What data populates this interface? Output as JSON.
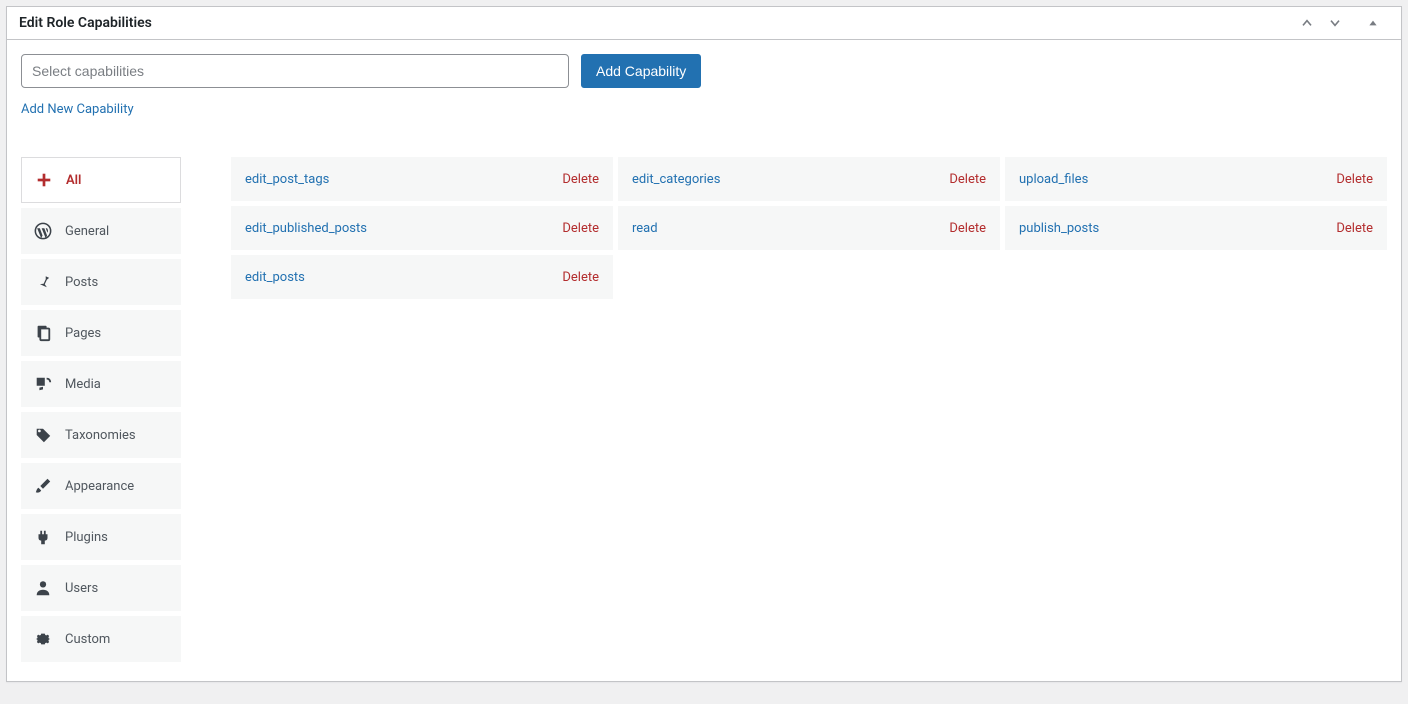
{
  "panel": {
    "title": "Edit Role Capabilities"
  },
  "search": {
    "placeholder": "Select capabilities"
  },
  "buttons": {
    "add_capability": "Add Capability",
    "add_new_capability": "Add New Capability"
  },
  "sidebar": {
    "items": [
      {
        "label": "All",
        "active": true
      },
      {
        "label": "General",
        "active": false
      },
      {
        "label": "Posts",
        "active": false
      },
      {
        "label": "Pages",
        "active": false
      },
      {
        "label": "Media",
        "active": false
      },
      {
        "label": "Taxonomies",
        "active": false
      },
      {
        "label": "Appearance",
        "active": false
      },
      {
        "label": "Plugins",
        "active": false
      },
      {
        "label": "Users",
        "active": false
      },
      {
        "label": "Custom",
        "active": false
      }
    ]
  },
  "capabilities": {
    "delete_label": "Delete",
    "items": [
      "edit_post_tags",
      "edit_categories",
      "upload_files",
      "edit_published_posts",
      "read",
      "publish_posts",
      "edit_posts"
    ]
  }
}
